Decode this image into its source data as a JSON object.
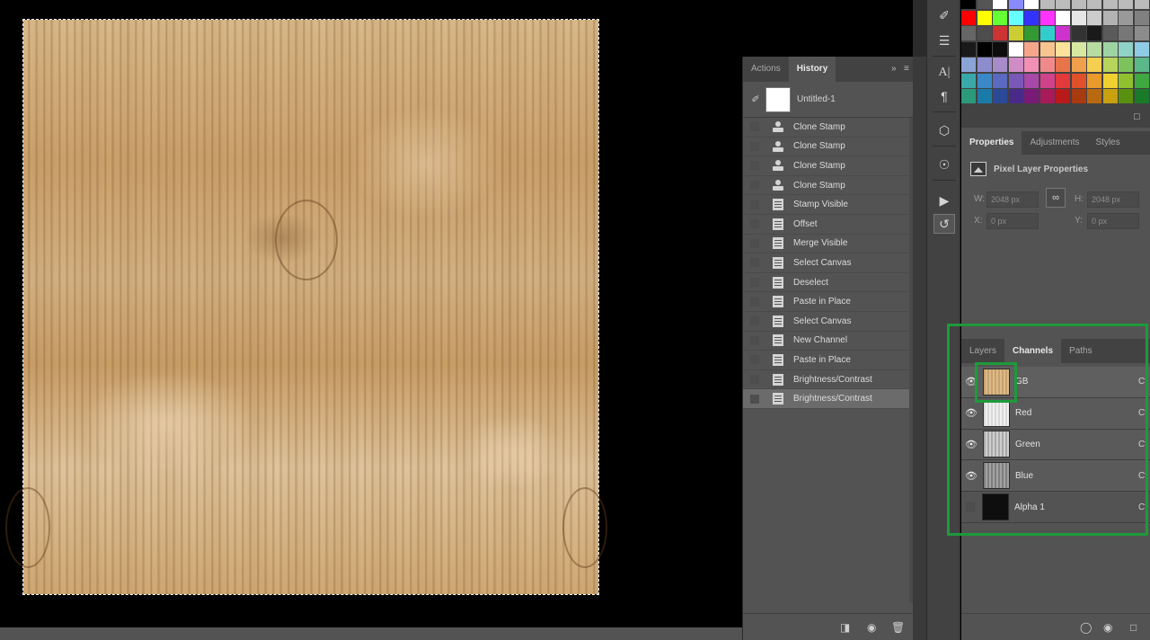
{
  "history": {
    "tabs": [
      "Actions",
      "History"
    ],
    "active_tab": "History",
    "snapshot_label": "Untitled-1",
    "items": [
      {
        "label": "Clone Stamp",
        "icon": "clone-stamp-icon"
      },
      {
        "label": "Clone Stamp",
        "icon": "clone-stamp-icon"
      },
      {
        "label": "Clone Stamp",
        "icon": "clone-stamp-icon"
      },
      {
        "label": "Clone Stamp",
        "icon": "clone-stamp-icon"
      },
      {
        "label": "Stamp Visible",
        "icon": "document-icon"
      },
      {
        "label": "Offset",
        "icon": "document-icon"
      },
      {
        "label": "Merge Visible",
        "icon": "document-icon"
      },
      {
        "label": "Select Canvas",
        "icon": "document-icon"
      },
      {
        "label": "Deselect",
        "icon": "document-icon"
      },
      {
        "label": "Paste in Place",
        "icon": "document-icon"
      },
      {
        "label": "Select Canvas",
        "icon": "document-icon"
      },
      {
        "label": "New Channel",
        "icon": "document-icon"
      },
      {
        "label": "Paste in Place",
        "icon": "document-icon"
      },
      {
        "label": "Brightness/Contrast",
        "icon": "document-icon"
      },
      {
        "label": "Brightness/Contrast",
        "icon": "document-icon"
      }
    ],
    "active_item": "Brightness/Contrast"
  },
  "properties": {
    "tabs": [
      "Properties",
      "Adjustments",
      "Styles"
    ],
    "active_tab": "Properties",
    "heading": "Pixel Layer Properties",
    "w_label": "W:",
    "w_value": "2048 px",
    "h_label": "H:",
    "h_value": "2048 px",
    "x_label": "X:",
    "x_value": "0 px",
    "y_label": "Y:",
    "y_value": "0 px"
  },
  "channels": {
    "tabs": [
      "Layers",
      "Channels",
      "Paths"
    ],
    "active_tab": "Channels",
    "rows": [
      {
        "label": "GB",
        "visible": true,
        "shortcut": "Ct"
      },
      {
        "label": "Red",
        "visible": true,
        "shortcut": "Ct"
      },
      {
        "label": "Green",
        "visible": true,
        "shortcut": "Ct"
      },
      {
        "label": "Blue",
        "visible": true,
        "shortcut": "Ct"
      },
      {
        "label": "Alpha 1",
        "visible": false,
        "shortcut": "Ct"
      }
    ]
  },
  "colors": {
    "highlight": "#1d9a3a",
    "panel_bg": "#535353",
    "panel_dark": "#424242"
  }
}
